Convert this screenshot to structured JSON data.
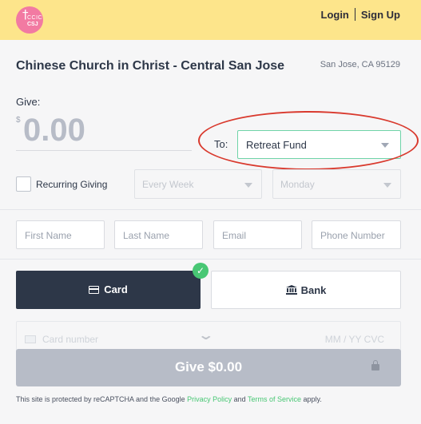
{
  "header": {
    "logo_cross": "†",
    "logo_line1": "CCIC",
    "logo_line2": "CSJ",
    "login": "Login",
    "signup": "Sign Up"
  },
  "church": {
    "name": "Chinese Church in Christ - Central San Jose",
    "location": "San Jose, CA 95129"
  },
  "give": {
    "label": "Give:",
    "currency": "$",
    "amount": "0.00",
    "to_label": "To:",
    "fund": "Retreat Fund"
  },
  "recurring": {
    "label": "Recurring Giving",
    "checked": false,
    "frequency": "Every Week",
    "day": "Monday"
  },
  "donor": {
    "first_name_placeholder": "First Name",
    "last_name_placeholder": "Last Name",
    "email_placeholder": "Email",
    "phone_placeholder": "Phone Number"
  },
  "payment": {
    "card_label": "Card",
    "bank_label": "Bank",
    "selected": "card",
    "card_number_placeholder": "Card number",
    "card_expiry_placeholder": "MM / YY  CVC",
    "submit_label": "Give $0.00"
  },
  "legal": {
    "prefix": "This site is protected by reCAPTCHA and the Google ",
    "privacy": "Privacy Policy",
    "and": " and ",
    "terms": "Terms of Service",
    "suffix": " apply."
  },
  "colors": {
    "header_bg": "#fde58b",
    "logo": "#f27aa2",
    "primary_dark": "#2d3748",
    "accent_green": "#48c774",
    "annotation_red": "#d93a2e"
  },
  "icons": [
    "card-icon",
    "bank-icon",
    "check-icon",
    "lock-icon",
    "chevron-down-icon"
  ]
}
